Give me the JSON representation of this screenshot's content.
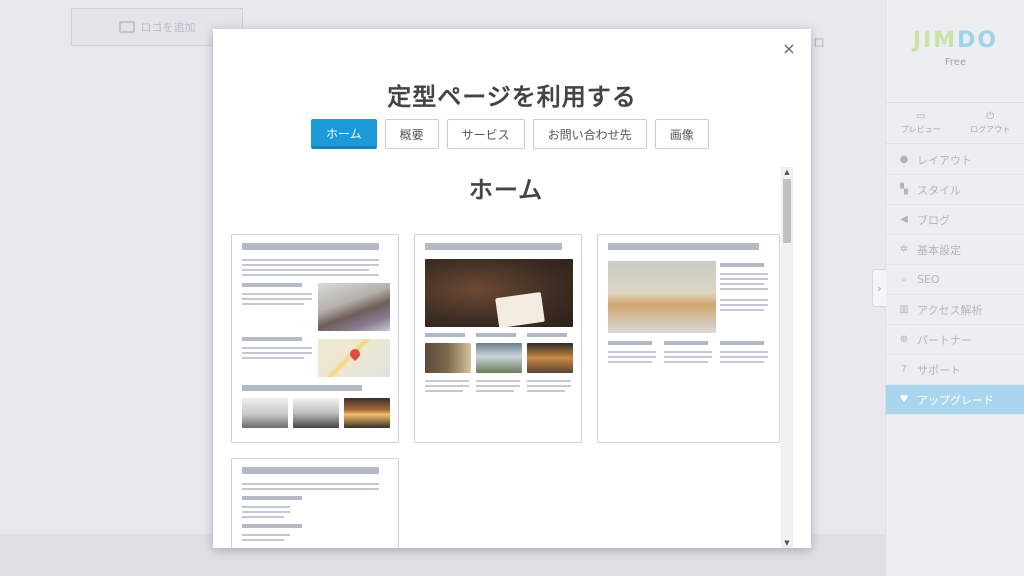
{
  "background": {
    "logo_slot_label": "ロゴを追加",
    "hint_text": "ロ"
  },
  "sidebar": {
    "brand": {
      "logo_part1": "JIM",
      "logo_part2": "DO",
      "plan": "Free"
    },
    "top_buttons": [
      {
        "label": "プレビュー",
        "icon": "monitor-icon"
      },
      {
        "label": "ログアウト",
        "icon": "power-icon"
      }
    ],
    "menu": [
      {
        "label": "レイアウト",
        "icon": "drops-icon"
      },
      {
        "label": "スタイル",
        "icon": "paint-roller-icon"
      },
      {
        "label": "ブログ",
        "icon": "megaphone-icon"
      },
      {
        "label": "基本設定",
        "icon": "gear-icon"
      },
      {
        "label": "SEO",
        "icon": "search-icon"
      },
      {
        "label": "アクセス解析",
        "icon": "bar-chart-icon"
      },
      {
        "label": "パートナー",
        "icon": "plus-circle-icon"
      },
      {
        "label": "サポート",
        "icon": "question-icon"
      },
      {
        "label": "アップグレード",
        "icon": "heart-icon"
      }
    ],
    "collapse_icon": "chevron-right-icon"
  },
  "modal": {
    "title": "定型ページを利用する",
    "close_glyph": "×",
    "tabs": [
      {
        "label": "ホーム",
        "active": true
      },
      {
        "label": "概要",
        "active": false
      },
      {
        "label": "サービス",
        "active": false
      },
      {
        "label": "お問い合わせ先",
        "active": false
      },
      {
        "label": "画像",
        "active": false
      }
    ],
    "section_title": "ホーム"
  },
  "colors": {
    "accent": "#1b9ad7",
    "upgrade": "#a9d6ee"
  }
}
